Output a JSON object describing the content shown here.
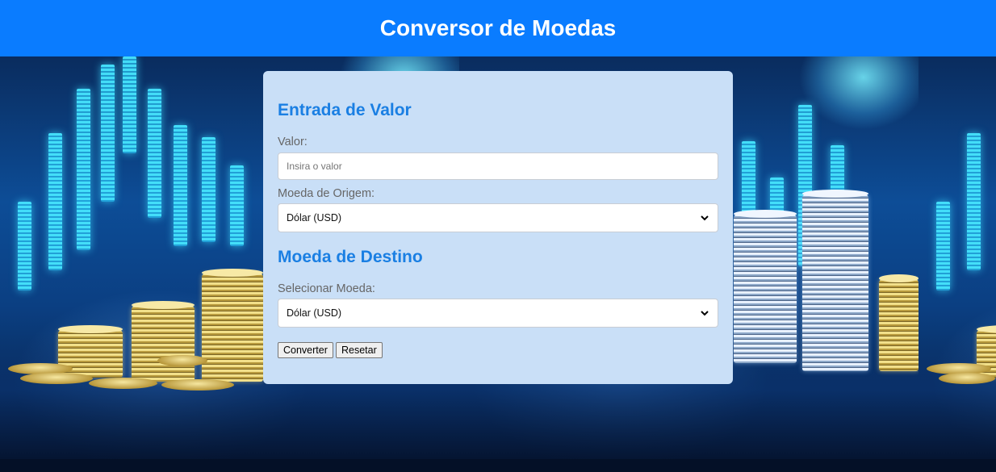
{
  "header": {
    "title": "Conversor de Moedas"
  },
  "form": {
    "section_input_title": "Entrada de Valor",
    "value_label": "Valor:",
    "value_input": {
      "value": "",
      "placeholder": "Insira o valor"
    },
    "origin_label": "Moeda de Origem:",
    "origin_select": {
      "selected": "Dólar (USD)"
    },
    "section_target_title": "Moeda de Destino",
    "target_label": "Selecionar Moeda:",
    "target_select": {
      "selected": "Dólar (USD)"
    },
    "convert_button": "Converter",
    "reset_button": "Resetar"
  },
  "colors": {
    "header_bg": "#0a7cff",
    "card_bg": "#c9dff7",
    "section_title": "#1a7fe3"
  },
  "icons": {
    "select_arrow": "chevron-down-icon"
  }
}
